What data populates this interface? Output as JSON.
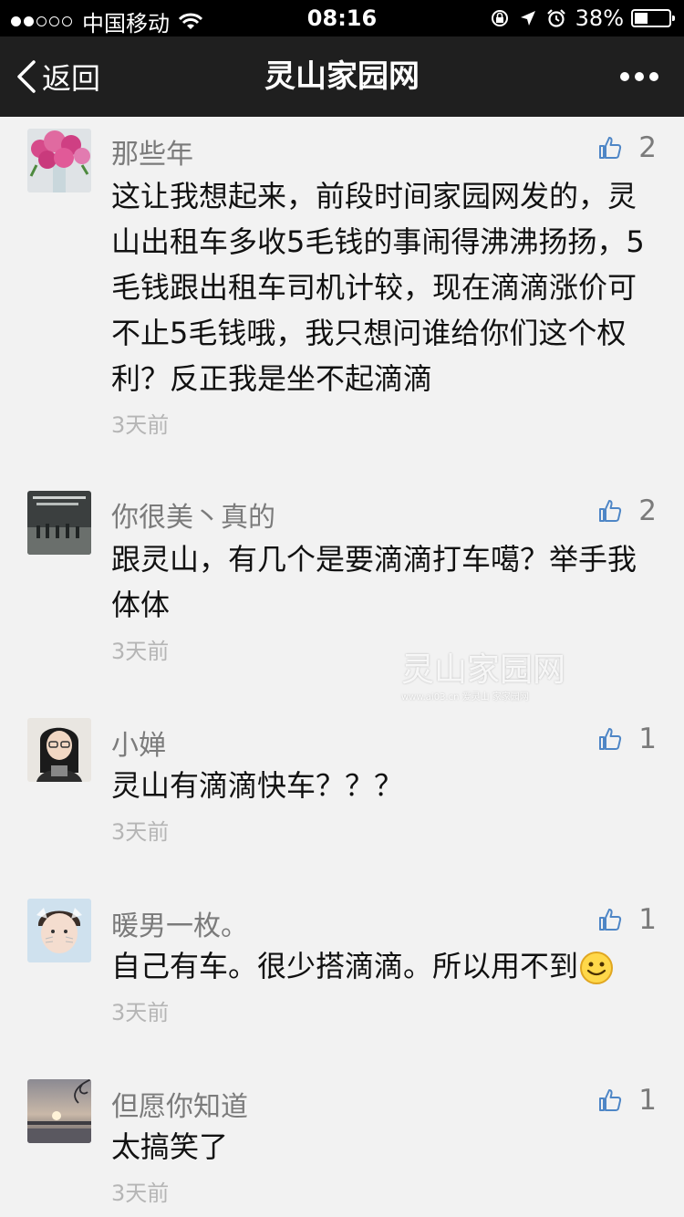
{
  "status_bar": {
    "carrier": "中国移动",
    "time": "08:16",
    "battery": "38%",
    "battery_level": 0.38
  },
  "nav": {
    "back_label": "返回",
    "title": "灵山家园网"
  },
  "watermark": {
    "text": "灵山家园网",
    "sub": "www.ai03.cn 爱灵山 家家园网"
  },
  "comments": [
    {
      "user": "那些年",
      "likes": "2",
      "text": "这让我想起来，前段时间家园网发的，灵山出租车多收5毛钱的事闹得沸沸扬扬，5毛钱跟出租车司机计较，现在滴滴涨价可不止5毛钱哦，我只想问谁给你们这个权利？反正我是坐不起滴滴",
      "time": "3天前"
    },
    {
      "user": "你很美丶真的",
      "likes": "2",
      "text": "跟灵山，有几个是要滴滴打车噶？举手我体体",
      "time": "3天前"
    },
    {
      "user": "小婵",
      "likes": "1",
      "text": "灵山有滴滴快车？？？",
      "time": "3天前"
    },
    {
      "user": "暖男一枚。",
      "likes": "1",
      "text": "自己有车。很少搭滴滴。所以用不到",
      "time": "3天前"
    },
    {
      "user": "但愿你知道",
      "likes": "1",
      "text": "太搞笑了",
      "time": "3天前"
    }
  ]
}
